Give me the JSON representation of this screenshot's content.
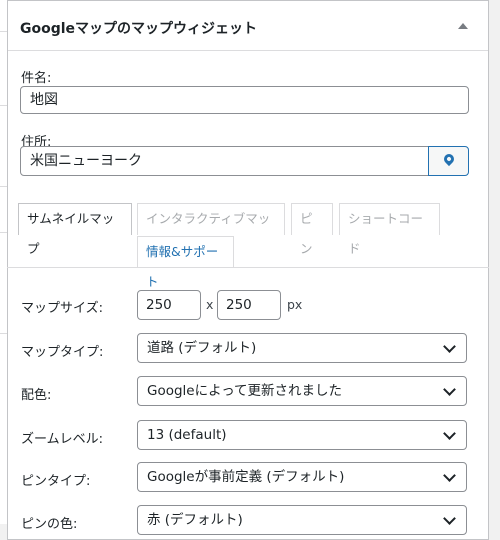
{
  "widget": {
    "title": "Googleマップのマップウィジェット"
  },
  "fields": {
    "subject_label": "件名:",
    "subject_value": "地図",
    "address_label": "住所:",
    "address_value": "米国ニューヨーク"
  },
  "tabs": [
    {
      "label": "サムネイルマップ"
    },
    {
      "label": "インタラクティブマップ"
    },
    {
      "label": "ピン"
    },
    {
      "label": "ショートコード"
    },
    {
      "label": "情報&サポート"
    }
  ],
  "settings": {
    "map_size_label": "マップサイズ:",
    "width": "250",
    "x_sep": "x",
    "height": "250",
    "unit": "px",
    "map_type_label": "マップタイプ:",
    "map_type_value": "道路 (デフォルト)",
    "color_label": "配色:",
    "color_value": "Googleによって更新されました",
    "zoom_label": "ズームレベル:",
    "zoom_value": "13 (default)",
    "pin_type_label": "ピンタイプ:",
    "pin_type_value": "Googleが事前定義 (デフォルト)",
    "pin_color_label": "ピンの色:",
    "pin_color_value": "赤 (デフォルト)"
  },
  "colors": {
    "accent": "#2271b1",
    "border": "#8c8f94"
  }
}
